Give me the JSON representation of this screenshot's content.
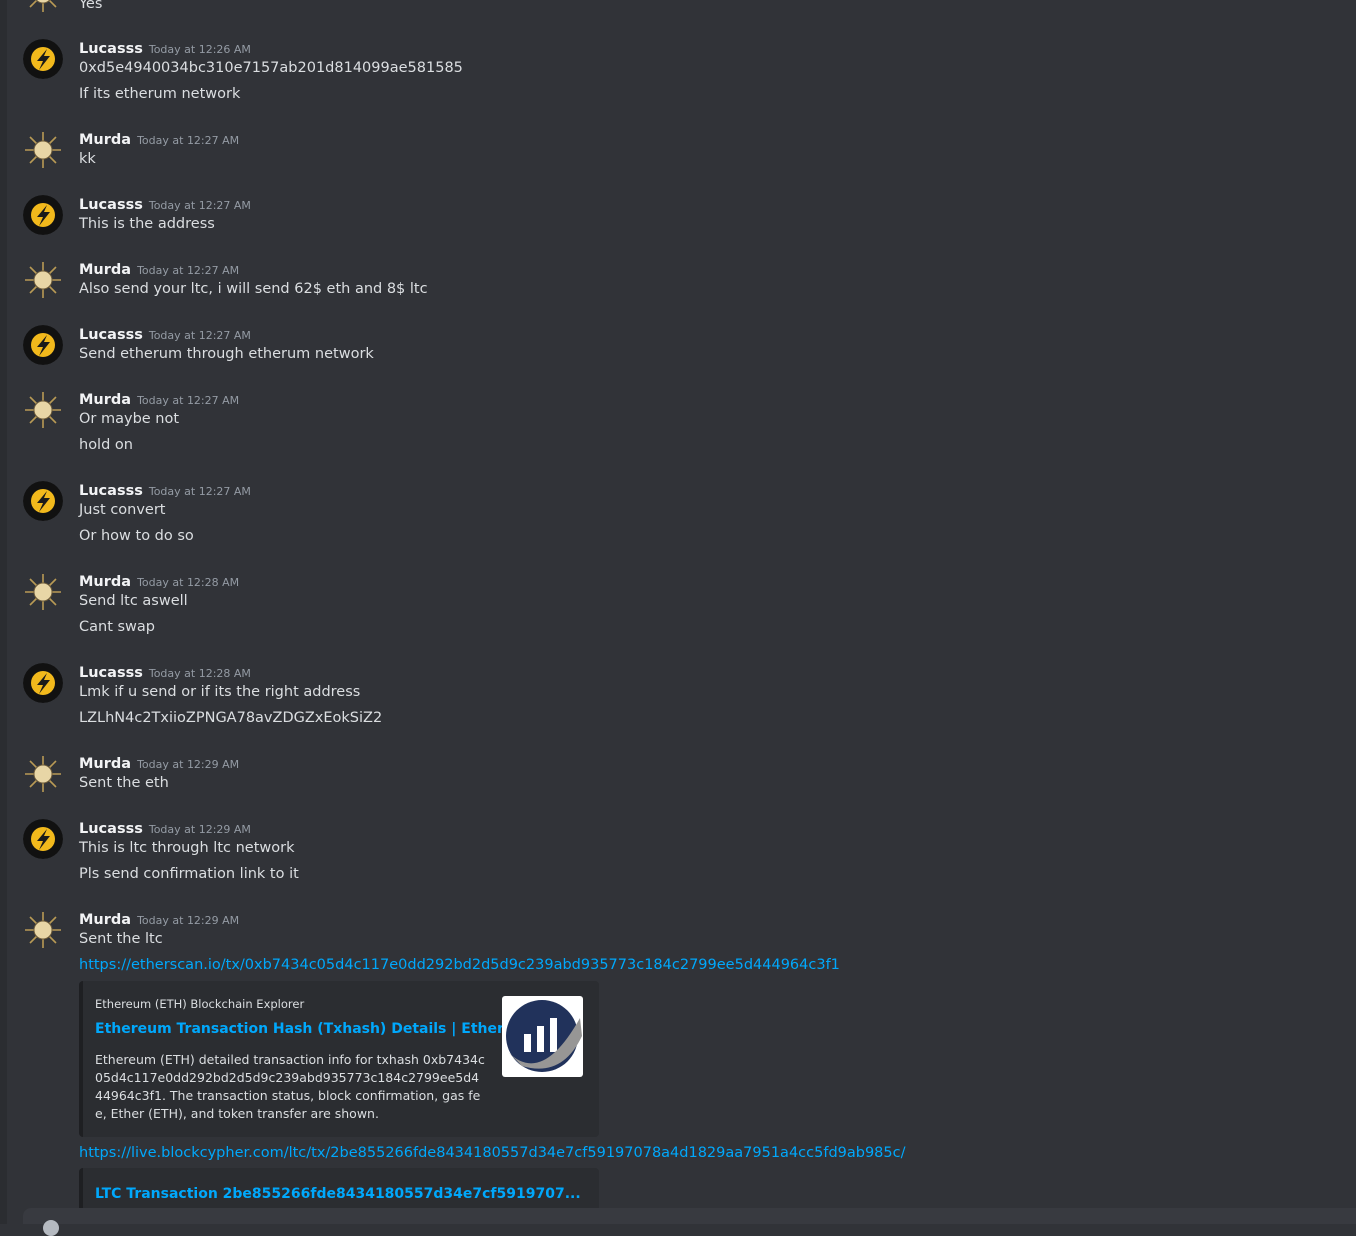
{
  "messages": [
    {
      "lines": [
        "Yes"
      ]
    },
    {
      "user": "Lucasss",
      "time": "Today at 12:26 AM",
      "lines": [
        "0xd5e4940034bc310e7157ab201d814099ae581585",
        "If its etherum network"
      ]
    },
    {
      "user": "Murda",
      "time": "Today at 12:27 AM",
      "lines": [
        "kk"
      ]
    },
    {
      "user": "Lucasss",
      "time": "Today at 12:27 AM",
      "lines": [
        "This is the address"
      ]
    },
    {
      "user": "Murda",
      "time": "Today at 12:27 AM",
      "lines": [
        "Also send your ltc, i will send 62$ eth and 8$ ltc"
      ]
    },
    {
      "user": "Lucasss",
      "time": "Today at 12:27 AM",
      "lines": [
        "Send etherum through etherum network"
      ]
    },
    {
      "user": "Murda",
      "time": "Today at 12:27 AM",
      "lines": [
        "Or maybe not",
        "hold on"
      ]
    },
    {
      "user": "Lucasss",
      "time": "Today at 12:27 AM",
      "lines": [
        "Just convert",
        "Or how to do so"
      ]
    },
    {
      "user": "Murda",
      "time": "Today at 12:28 AM",
      "lines": [
        "Send ltc aswell",
        "Cant swap"
      ]
    },
    {
      "user": "Lucasss",
      "time": "Today at 12:28 AM",
      "lines": [
        "Lmk if u send or if its the right address",
        "LZLhN4c2TxiioZPNGA78avZDGZxEokSiZ2"
      ]
    },
    {
      "user": "Murda",
      "time": "Today at 12:29 AM",
      "lines": [
        "Sent the eth"
      ]
    },
    {
      "user": "Lucasss",
      "time": "Today at 12:29 AM",
      "lines": [
        "This is ltc through ltc network",
        "Pls send confirmation link to it"
      ]
    },
    {
      "user": "Murda",
      "time": "Today at 12:29 AM",
      "lines": [
        "Sent the ltc"
      ],
      "links": [
        "https://etherscan.io/tx/0xb7434c05d4c117e0dd292bd2d5d9c239abd935773c184c2799ee5d444964c3f1",
        "https://live.blockcypher.com/ltc/tx/2be855266fde8434180557d34e7cf59197078a4d1829aa7951a4cc5fd9ab985c/"
      ]
    }
  ],
  "embeds": {
    "etherscan": {
      "provider": "Ethereum (ETH) Blockchain Explorer",
      "title": "Ethereum Transaction Hash (Txhash) Details | Etherscan",
      "description": "Ethereum (ETH) detailed transaction info for txhash 0xb7434c05d4c117e0dd292bd2d5d9c239abd935773c184c2799ee5d444964c3f1. The transaction status, block confirmation, gas fee, Ether (ETH), and token transfer are shown."
    },
    "blockcypher": {
      "title": "LTC Transaction 2be855266fde8434180557d34e7cf5919707..."
    }
  },
  "colors": {
    "background": "#313338",
    "link": "#00a8fc",
    "embed": "#2b2d31"
  },
  "icons": {
    "lucasss_avatar": "lightning-avatar-icon",
    "murda_avatar": "sun-face-avatar-icon",
    "etherscan_logo": "etherscan-logo-icon"
  }
}
